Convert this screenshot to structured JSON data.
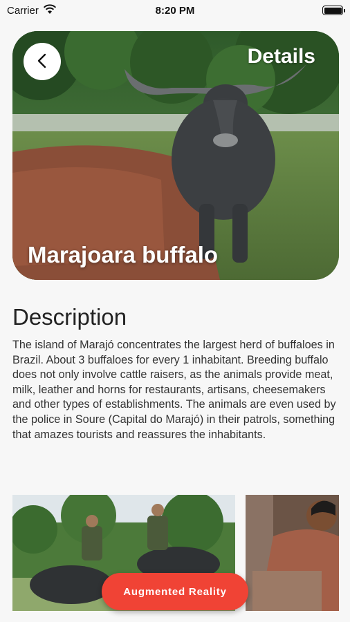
{
  "status_bar": {
    "carrier": "Carrier",
    "time": "8:20 PM",
    "battery_level": 1.0
  },
  "header": {
    "title": "Details"
  },
  "animal": {
    "name": "Marajoara buffalo"
  },
  "description": {
    "heading": "Description",
    "text": "The island of Marajó concentrates the largest herd of buffaloes in Brazil. About 3 buffaloes for every 1 inhabitant. Breeding buffalo does not only involve cattle raisers, as the animals provide meat, milk, leather and horns for restaurants, artisans, cheesemakers and other types of establishments. The animals are even used by the police in Soure (Capital do Marajó) in their patrols, something that amazes tourists and reassures the inhabitants."
  },
  "actions": {
    "ar_label": "Augmented Reality"
  },
  "icons": {
    "back": "chevron-left-icon",
    "wifi": "wifi-icon",
    "battery": "battery-icon"
  },
  "colors": {
    "accent": "#f04335",
    "background": "#f7f7f7"
  }
}
